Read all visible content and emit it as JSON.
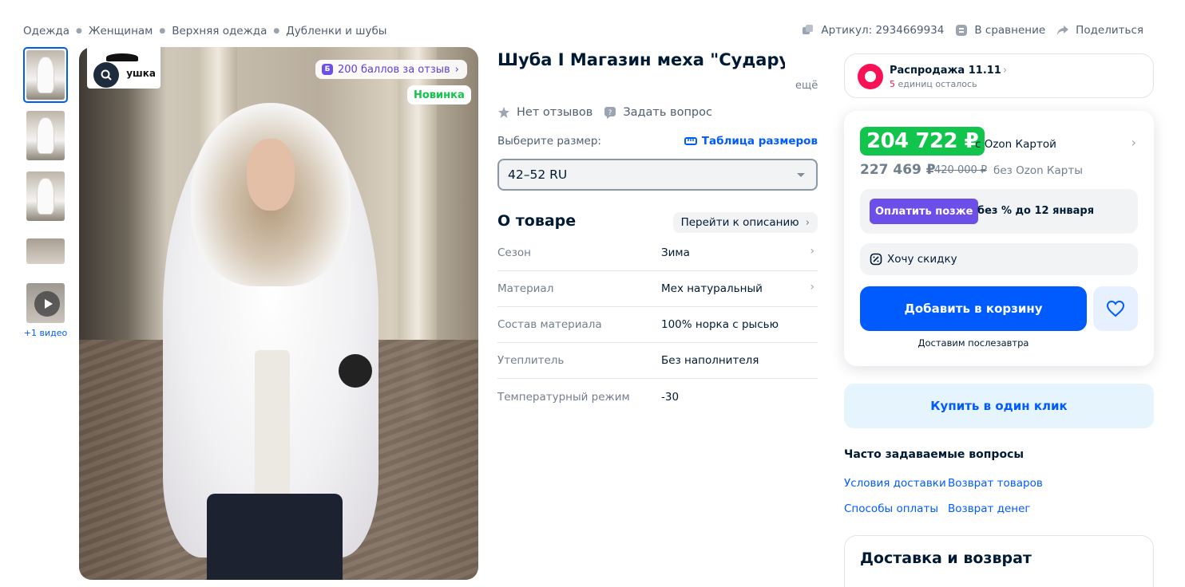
{
  "breadcrumbs": [
    "Одежда",
    "Женщинам",
    "Верхняя одежда",
    "Дубленки и шубы"
  ],
  "top_actions": {
    "article": "Артикул: 2934669934",
    "compare": "В сравнение",
    "share": "Поделиться"
  },
  "gallery": {
    "video_label": "+1 видео",
    "logo_text": "ушка",
    "points_badge": "200 баллов за отзыв",
    "points_icon": "Б",
    "new_badge": "Новинка"
  },
  "product": {
    "title": "Шуба I Магазин меха \"Сударушка\" I Норковая женс",
    "title_more": "ещё",
    "reviews": "Нет отзывов",
    "ask": "Задать вопрос",
    "size_label": "Выберите размер:",
    "size_table": "Таблица размеров",
    "size_value": "42–52 RU",
    "about_title": "О товаре",
    "about_link": "Перейти к описанию",
    "props": [
      {
        "name": "Сезон",
        "value": "Зима"
      },
      {
        "name": "Материал",
        "value": "Мех натуральный"
      },
      {
        "name": "Состав материала",
        "value": "100% норка с рысью"
      },
      {
        "name": "Утеплитель",
        "value": "Без наполнителя"
      },
      {
        "name": "Температурный режим",
        "value": "-30"
      }
    ]
  },
  "sale": {
    "title": "Распродажа 11.11",
    "count": "5",
    "sub": "единиц осталось"
  },
  "price": {
    "card_price": "204 722 ₽",
    "card_label": "с Ozon Картой",
    "price": "227 469 ₽",
    "old_price": "420 000 ₽",
    "no_card_label": "без Ozon Карты",
    "pay_later_btn": "Оплатить позже",
    "pay_later_text": "без % до 12 января",
    "discount": "Хочу скидку",
    "add_to_cart": "Добавить в корзину",
    "delivery_note": "Доставим послезавтра"
  },
  "buy_one_click": "Купить в один клик",
  "faq": {
    "title": "Часто задаваемые вопросы",
    "links": [
      "Условия доставки",
      "Возврат товаров",
      "Способы оплаты",
      "Возврат денег"
    ]
  },
  "delivery_card_title": "Доставка и возврат",
  "colors": {
    "accent": "#005bff",
    "green": "#10c44c",
    "purple": "#6b4fe8",
    "sale_pink": "#f91155"
  }
}
